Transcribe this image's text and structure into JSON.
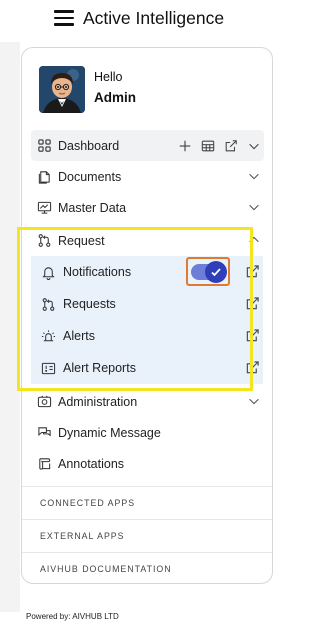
{
  "header": {
    "title": "Active Intelligence",
    "menu_icon": "hamburger-icon"
  },
  "profile": {
    "greeting": "Hello",
    "name": "Admin"
  },
  "menu": {
    "dashboard": {
      "label": "Dashboard",
      "icon": "dashboard-grid-icon",
      "tools": [
        "plus-icon",
        "table-icon",
        "external-link-icon",
        "chevron-down-icon"
      ]
    },
    "documents": {
      "label": "Documents",
      "icon": "documents-icon"
    },
    "master_data": {
      "label": "Master Data",
      "icon": "master-data-icon"
    },
    "request": {
      "label": "Request",
      "icon": "request-icon",
      "expanded": true
    },
    "request_children": [
      {
        "label": "Notifications",
        "icon": "bell-icon",
        "toggle_on": true
      },
      {
        "label": "Requests",
        "icon": "request-icon"
      },
      {
        "label": "Alerts",
        "icon": "alert-icon"
      },
      {
        "label": "Alert Reports",
        "icon": "alert-report-icon"
      }
    ],
    "administration": {
      "label": "Administration",
      "icon": "administration-icon"
    },
    "dynamic_message": {
      "label": "Dynamic Message",
      "icon": "message-icon"
    },
    "annotations": {
      "label": "Annotations",
      "icon": "annotation-icon"
    }
  },
  "links": {
    "connected_apps": "CONNECTED APPS",
    "external_apps": "EXTERNAL APPS",
    "documentation": "AIVHUB DOCUMENTATION"
  },
  "footer": {
    "powered_by": "Powered by: AIVHUB LTD"
  },
  "colors": {
    "highlight_border": "#f3e621",
    "toggle_outline": "#e07a2e",
    "toggle_on": "#2f3fb8",
    "submenu_bg": "#e9f1fb"
  }
}
